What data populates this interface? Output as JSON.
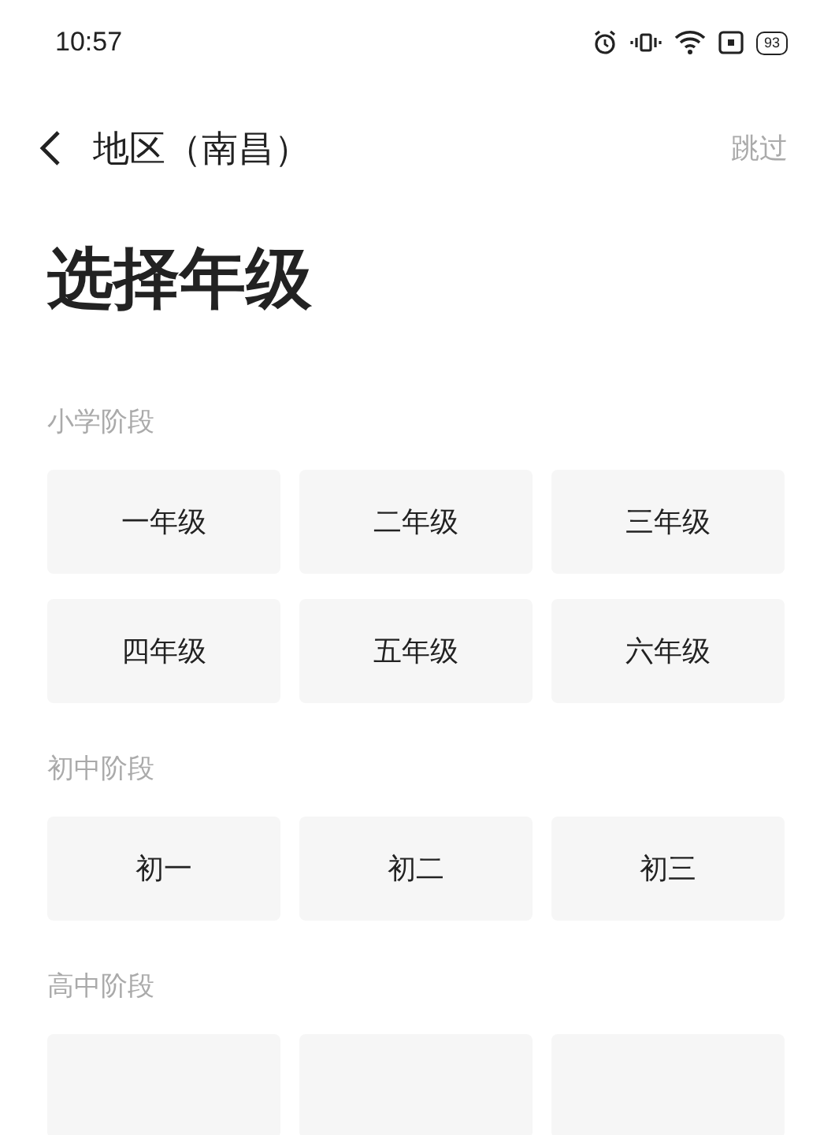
{
  "status_bar": {
    "time": "10:57",
    "battery": "93"
  },
  "nav": {
    "title": "地区（南昌）",
    "skip": "跳过"
  },
  "heading": "选择年级",
  "sections": [
    {
      "title": "小学阶段",
      "grades": [
        {
          "label": "一年级",
          "selected": false
        },
        {
          "label": "二年级",
          "selected": false
        },
        {
          "label": "三年级",
          "selected": false
        },
        {
          "label": "四年级",
          "selected": false
        },
        {
          "label": "五年级",
          "selected": false
        },
        {
          "label": "六年级",
          "selected": false
        }
      ]
    },
    {
      "title": "初中阶段",
      "grades": [
        {
          "label": "初一",
          "selected": false
        },
        {
          "label": "初二",
          "selected": false
        },
        {
          "label": "初三",
          "selected": false
        }
      ]
    },
    {
      "title": "高中阶段"
    }
  ]
}
